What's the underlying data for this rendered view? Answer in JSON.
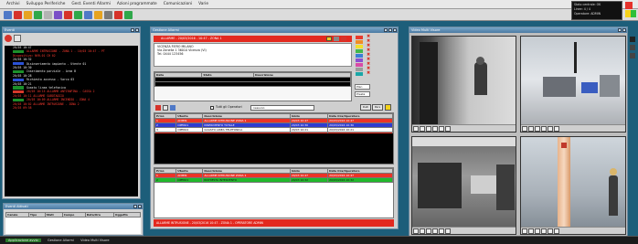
{
  "menu": [
    "Archivi",
    "Sviluppo Periferiche",
    "Gest. Eventi Allarmi",
    "Azioni programmate",
    "Comunicazioni",
    "Varie"
  ],
  "left_window": {
    "title": "Eventi",
    "log_lines": [
      {
        "text": "20/03 10:47",
        "color": "wht",
        "tag": ""
      },
      {
        "text": "ALLARME INTRUSIONE - ZONA 1 - 10/03 10:47 - PT",
        "color": "red",
        "tag": "#1c8f2a"
      },
      {
        "text": "Dispositivo: NVR-01  CH 02",
        "color": "red",
        "tag": ""
      },
      {
        "text": "20/03 10:32",
        "color": "wht",
        "tag": ""
      },
      {
        "text": "Disinserimento impianto - Utente 01",
        "color": "wht",
        "tag": "#2b52d6"
      },
      {
        "text": "20/03 10:30",
        "color": "wht",
        "tag": ""
      },
      {
        "text": "Inserimento parziale - Area B",
        "color": "wht",
        "tag": "#1c8f2a"
      },
      {
        "text": "20/03 10:28",
        "color": "wht",
        "tag": ""
      },
      {
        "text": "Richiesta accesso - Varco 03",
        "color": "wht",
        "tag": "#2b52d6"
      },
      {
        "text": "20/03 10:21",
        "color": "wht",
        "tag": ""
      },
      {
        "text": "Guasto linea telefonica",
        "color": "wht",
        "tag": "#1c8f2a"
      },
      {
        "text": "20/03 10:15 ALLARME ANTIRAPINA - CASSA 2",
        "color": "red",
        "tag": "#d63a2b"
      },
      {
        "text": "20/03 10:11 ALLARME SABOTAGGIO",
        "color": "red",
        "tag": ""
      },
      {
        "text": "20/03 10:09 ALLARME INCENDIO - ZONA 4",
        "color": "red",
        "tag": "#1c8f2a"
      },
      {
        "text": "20/03 10:02 ALLARME INTRUSIONE - ZONA 2",
        "color": "red",
        "tag": ""
      },
      {
        "text": "20/03 09:58",
        "color": "red",
        "tag": ""
      }
    ]
  },
  "bottom_left_window": {
    "title": "Eventi Attivati",
    "headers": [
      "Canale",
      "Tipo",
      "Stati",
      "Campo",
      "Data/Ora",
      "Oggetto"
    ]
  },
  "center_window": {
    "title": "Gestione Allarmi",
    "alarm_header": "ALLARME - 20/03/2016 - 10:47 - ZONA 1",
    "info_lines": [
      "VICENZA FIERO MILANO",
      "Via Zanella 1  36010 Vicenza (VI)",
      "Tel. 0444 123456"
    ],
    "grid1_headers": [
      "Data",
      "Stato",
      "Descrizione"
    ],
    "filter_label": "Tutti gli Operatori",
    "filter_value": "nessuno",
    "btn_a": "Dati",
    "btn_b": "Pers",
    "label_plan": "Plan",
    "label_presta": "Presta",
    "events_headers": [
      "Prior.",
      "Utente",
      "Descrizione",
      "Inizio",
      "Data Ora/Operatore"
    ],
    "events_rows": [
      {
        "cells": [
          "1",
          "ADMIN",
          "ALLARME INTRUSIONE ZONA 1",
          "20/03 10:47",
          "20/03/2016 10:47"
        ],
        "bg": "#ec3326",
        "fg": "#fff"
      },
      {
        "cells": [
          "2",
          "OPER01",
          "INSERIMENTO TOTALE",
          "20/03 10:30",
          "20/03/2016 10:30"
        ],
        "bg": "#2f3bd0",
        "fg": "#fff"
      },
      {
        "cells": [
          "3",
          "OPER02",
          "GUASTO LINEA TELEFONICA",
          "20/03 10:21",
          "20/03/2016 10:21"
        ],
        "bg": "#ffffff",
        "fg": "#111"
      },
      {
        "cells": [
          "4",
          "ADMIN",
          "ALLARME ANTIRAPINA",
          "20/03 10:15",
          "20/03/2016 10:15"
        ],
        "bg": "#ec3326",
        "fg": "#fff"
      }
    ],
    "operators_headers": [
      "Prior.",
      "Utente",
      "Descrizione",
      "Inizio",
      "Data Ora/Operatore"
    ],
    "operators_rows": [
      {
        "cells": [
          "1",
          "ADMIN",
          "ALLARME INTRUSIONE ZONA 1",
          "20/03 10:47",
          "20/03/2016 10:47"
        ],
        "bg": "#ec3326",
        "fg": "#fff"
      },
      {
        "cells": [
          "2",
          "OPER01",
          "RICHIESTA INTERVENTO",
          "20/03 10:32",
          "20/03/2016 10:32"
        ],
        "bg": "#21b82c",
        "fg": "#111"
      }
    ],
    "footer": "ALLARME INTRUSIONE - 20/03/2016 10:47 - ZONA 1 - OPERATORE ADMIN"
  },
  "video_window": {
    "title": "Video Multi Visore"
  },
  "status": {
    "lines": [
      "Stato centrale: OK",
      "Linee: 4 / 4",
      "Operatore: ADMIN"
    ],
    "colors": [
      "#e5322b",
      "#f5d21a",
      "#2fbf3a"
    ]
  },
  "taskbar": {
    "start": "Applicazione avvio",
    "items": [
      "Gestione Allarmi",
      "Video Multi Visore"
    ]
  },
  "palette": {
    "toolbar_icons": [
      "#4f79c7",
      "#d6332a",
      "#e6a320",
      "#2fa84a",
      "#b3b3b3",
      "#7a4fc7",
      "#d6332a",
      "#2fa84a",
      "#4f79c7",
      "#e6a320",
      "#7a7a7a",
      "#d6332a",
      "#2fa84a"
    ],
    "side_colors": [
      "#e83a2c",
      "#f18c24",
      "#f3df27",
      "#43b84a",
      "#3a7fd6",
      "#8b4fd0",
      "#d94aa6",
      "#9b9b9b",
      "#1aa7a7"
    ]
  }
}
